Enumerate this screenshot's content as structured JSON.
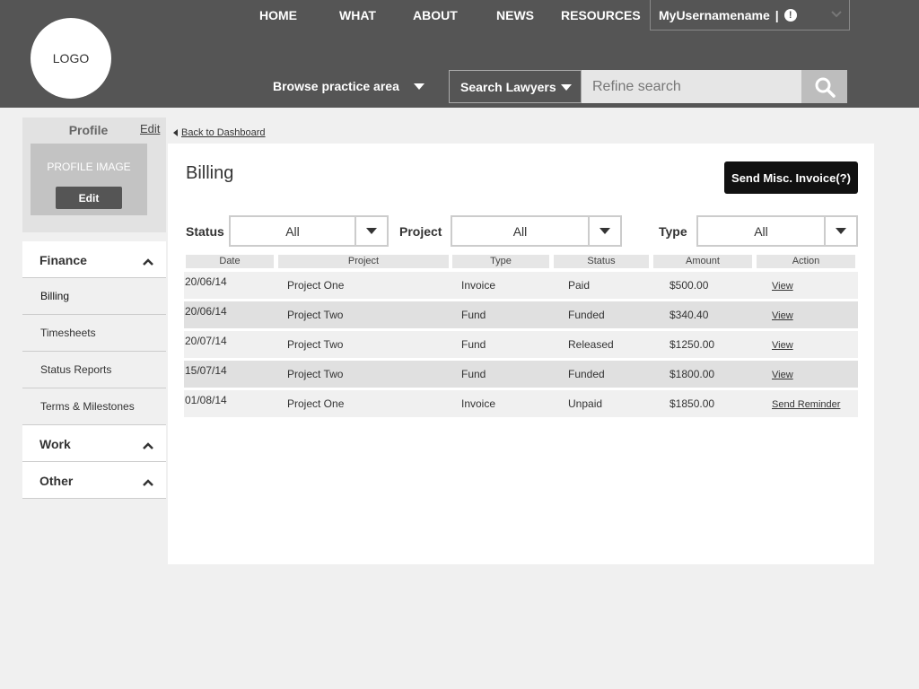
{
  "header": {
    "logo": "LOGO",
    "nav": [
      "HOME",
      "WHAT",
      "ABOUT",
      "NEWS",
      "RESOURCES"
    ],
    "username": "MyUsernamename",
    "separator": "|",
    "alert_glyph": "!",
    "browse_label": "Browse practice area",
    "search_select": "Search Lawyers",
    "search_placeholder": "Refine search"
  },
  "sidebar": {
    "profile_title": "Profile",
    "profile_edit": "Edit",
    "profile_image_label": "PROFILE IMAGE",
    "profile_image_edit": "Edit",
    "finance_label": "Finance",
    "finance_items": [
      "Billing",
      "Timesheets",
      "Status Reports",
      "Terms & Milestones"
    ],
    "work_label": "Work",
    "other_label": "Other"
  },
  "main": {
    "back_link": "Back to Dashboard",
    "title": "Billing",
    "invoice_button": "Send Misc. Invoice(?)",
    "filters": {
      "status_label": "Status",
      "status_value": "All",
      "project_label": "Project",
      "project_value": "All",
      "type_label": "Type",
      "type_value": "All"
    },
    "table": {
      "headers": [
        "Date",
        "Project",
        "Type",
        "Status",
        "Amount",
        "Action"
      ],
      "rows": [
        {
          "date": "20/06/14",
          "project": "Project One",
          "type": "Invoice",
          "status": "Paid",
          "amount": "$500.00",
          "action": "View"
        },
        {
          "date": "20/06/14",
          "project": "Project Two",
          "type": "Fund",
          "status": "Funded",
          "amount": "$340.40",
          "action": "View"
        },
        {
          "date": "20/07/14",
          "project": "Project Two",
          "type": "Fund",
          "status": "Released",
          "amount": "$1250.00",
          "action": "View"
        },
        {
          "date": "15/07/14",
          "project": "Project Two",
          "type": "Fund",
          "status": "Funded",
          "amount": "$1800.00",
          "action": "View"
        },
        {
          "date": "01/08/14",
          "project": "Project One",
          "type": "Invoice",
          "status": "Unpaid",
          "amount": "$1850.00",
          "action": "Send Reminder"
        }
      ]
    }
  }
}
